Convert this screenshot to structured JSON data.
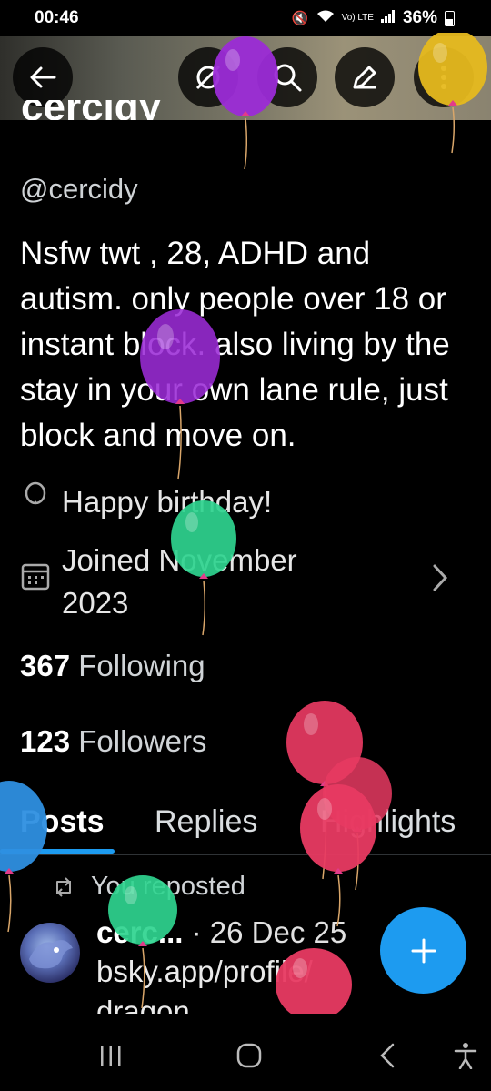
{
  "status_bar": {
    "time": "00:46",
    "network_label": "Vo) LTE",
    "battery": "36%"
  },
  "header": {
    "back_icon": "arrow-left-icon",
    "grok_icon": "grok-icon",
    "search_icon": "search-icon",
    "edit_icon": "pencil-icon",
    "more_icon": "more-vertical-icon"
  },
  "profile": {
    "display_name_partial": "cercidy",
    "handle": "@cercidy",
    "bio": "Nsfw twt , 28, ADHD and autism.  only people over 18 or instant block.  also living by the stay in your own lane rule, just block and move on.",
    "birthday_text": "Happy birthday!",
    "joined_line1": "Joined November",
    "joined_line2": "2023",
    "following_count": "367",
    "following_label": "Following",
    "followers_count": "123",
    "followers_label": "Followers"
  },
  "tabs": [
    {
      "label": "Posts",
      "active": true
    },
    {
      "label": "Replies",
      "active": false
    },
    {
      "label": "Highlights",
      "active": false
    }
  ],
  "post": {
    "repost_text": "You reposted",
    "author": "cerc...",
    "separator": "·",
    "date": "26 Dec 25",
    "body_line1": "bsky.app/profile/",
    "body_line2": "dragon"
  },
  "colors": {
    "accent": "#1d9bf0",
    "balloon_purple": "#9b2bd6",
    "balloon_yellow": "#e6b91e",
    "balloon_green": "#2fd48f",
    "balloon_red": "#e83a62",
    "balloon_blue": "#2e8fe0"
  }
}
